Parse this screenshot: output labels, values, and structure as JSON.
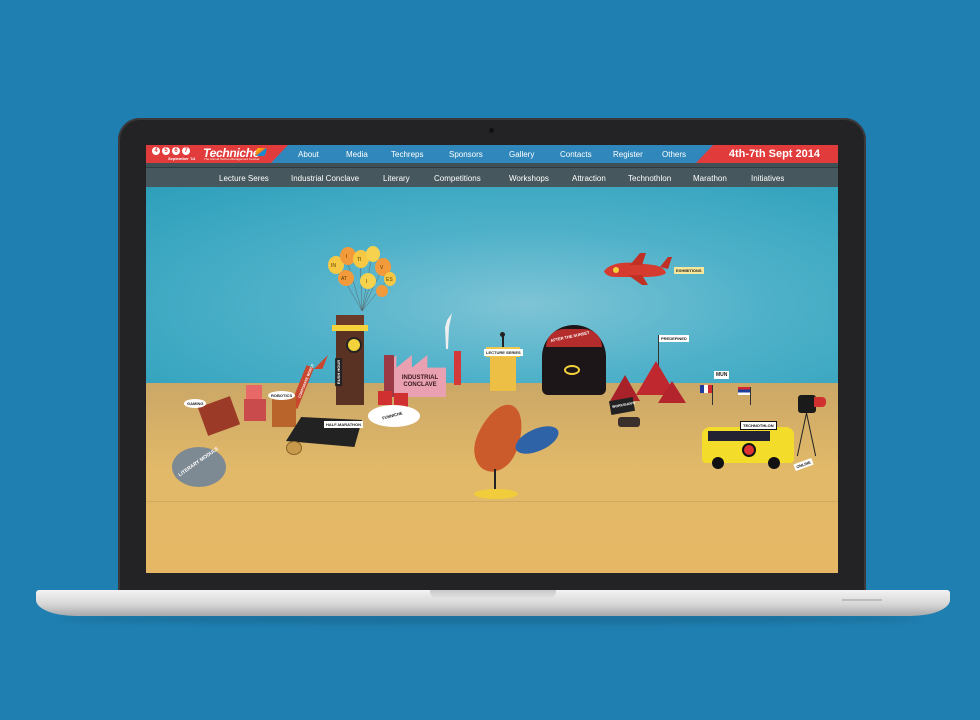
{
  "header": {
    "date_digits": [
      "4",
      "5",
      "6",
      "7"
    ],
    "date_caption": "September '14",
    "brand_name": "Techniche",
    "brand_tagline": "The Annual Techno-Management Festival",
    "nav": [
      "About",
      "Media",
      "Techreps",
      "Sponsors",
      "Gallery",
      "Contacts",
      "Register",
      "Others"
    ],
    "event_dates": "4th-7th Sept 2014"
  },
  "subnav": [
    "Lecture Seres",
    "Industrial Conclave",
    "Literary",
    "Competitions",
    "Workshops",
    "Attraction",
    "Technothlon",
    "Marathon",
    "Initiatives"
  ],
  "scene": {
    "balloon_letters": [
      "IN",
      "I",
      "TI",
      "AT",
      "I",
      "V",
      "ES"
    ],
    "rush_hour": "RUSH HOUR",
    "industrial_conclave": "INDUSTRIAL CONCLAVE",
    "lecture_series": "LECTURE SERIES",
    "after_the_sunset": "AFTER THE SUNSET",
    "exhibitions": "EXHIBITIONS",
    "predefined": "PREDEFINED",
    "mun": "MUN",
    "technothlon": "TECHNOTHLON",
    "online": "ONLINE",
    "workshops": "WORKSHOPS",
    "corporate_world": "CORPORATE WORLD",
    "robotics": "ROBOTICS",
    "half_marathon": "HALF-MARATHON",
    "funniche": "FUNNICHE",
    "literary_module": "LITERARY MODULE",
    "gaming": "GAMING"
  },
  "colors": {
    "background": "#1f7fb1",
    "nav_blue": "#2f87bb",
    "accent_red": "#e23b3b",
    "subnav_gray": "#46575d"
  }
}
